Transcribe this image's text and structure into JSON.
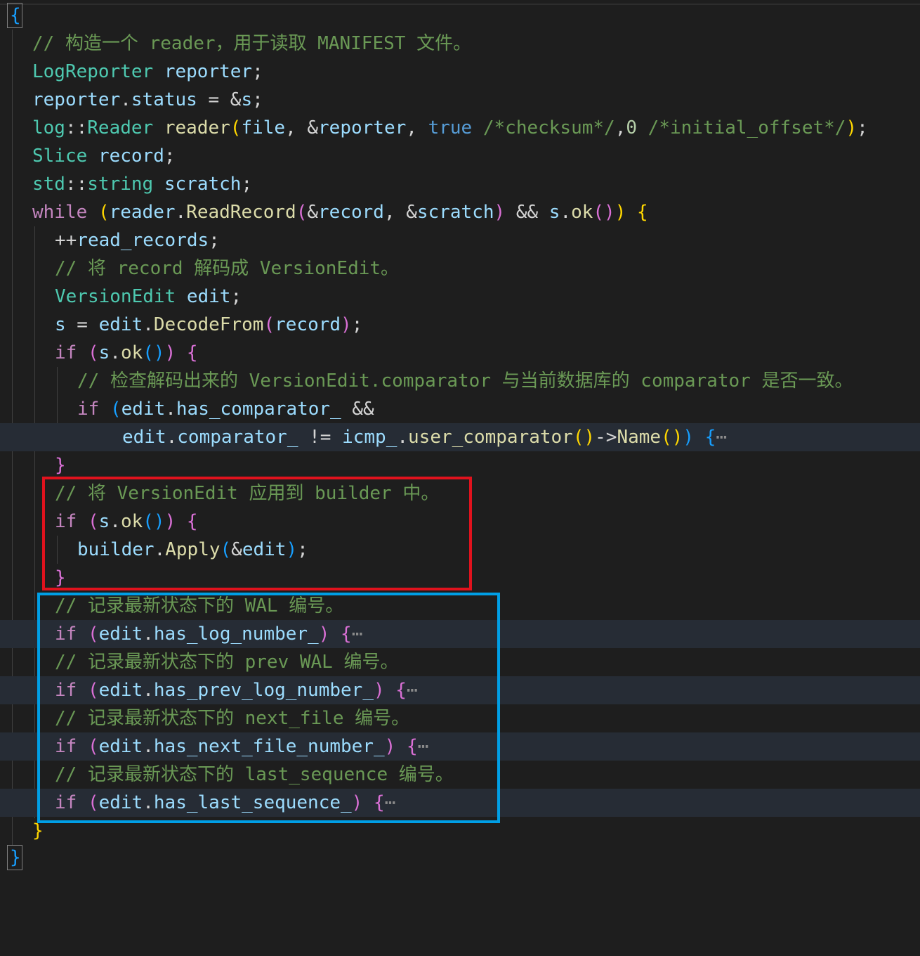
{
  "editor": {
    "lines": [
      {
        "id": "L0",
        "text": "{"
      },
      {
        "id": "L1",
        "comment": "// 构造一个 reader，用于读取 MANIFEST 文件。"
      },
      {
        "id": "L2",
        "type": "LogReporter",
        "var": "reporter",
        "end": ";"
      },
      {
        "id": "L3",
        "a": "reporter",
        "b": ".",
        "c": "status",
        "d": " = &",
        "e": "s",
        "f": ";"
      },
      {
        "id": "L4",
        "t1": "log",
        "t2": "::",
        "t3": "Reader",
        "v1": "reader",
        "v2": "file",
        "v3": "reporter",
        "kw": "true",
        "com1": "/*checksum*/",
        "num": "0",
        "com2": "/*initial_offset*/"
      },
      {
        "id": "L5",
        "type": "Slice",
        "var": "record",
        "end": ";"
      },
      {
        "id": "L6",
        "t1": "std",
        "t2": "::",
        "t3": "string",
        "var": "scratch",
        "end": ";"
      },
      {
        "id": "L7",
        "kw": "while",
        "v1": "reader",
        "fn1": "ReadRecord",
        "v2": "record",
        "v3": "scratch",
        "op": "&&",
        "v4": "s",
        "fn2": "ok"
      },
      {
        "id": "L8",
        "pre": "++",
        "var": "read_records",
        "end": ";"
      },
      {
        "id": "L9",
        "comment": "// 将 record 解码成 VersionEdit。"
      },
      {
        "id": "L10",
        "type": "VersionEdit",
        "var": "edit",
        "end": ";"
      },
      {
        "id": "L11",
        "v1": "s",
        "v2": "edit",
        "fn": "DecodeFrom",
        "v3": "record"
      },
      {
        "id": "L12",
        "kw": "if",
        "v1": "s",
        "fn": "ok"
      },
      {
        "id": "L13",
        "comment": "// 检查解码出来的 VersionEdit.comparator 与当前数据库的 comparator 是否一致。"
      },
      {
        "id": "L14",
        "kw": "if",
        "v1": "edit",
        "v2": "has_comparator_",
        "op": "&&"
      },
      {
        "id": "L15",
        "v1": "edit",
        "v2": "comparator_",
        "op": "!=",
        "v3": "icmp_",
        "fn1": "user_comparator",
        "arrow": "->",
        "fn2": "Name",
        "ellipsis": "⋯"
      },
      {
        "id": "L16",
        "text": "}"
      },
      {
        "id": "L17",
        "comment": "// 将 VersionEdit 应用到 builder 中。"
      },
      {
        "id": "L18",
        "kw": "if",
        "v1": "s",
        "fn": "ok"
      },
      {
        "id": "L19",
        "v1": "builder",
        "fn": "Apply",
        "v2": "edit"
      },
      {
        "id": "L20",
        "text": "}"
      },
      {
        "id": "L21",
        "comment": "// 记录最新状态下的 WAL 编号。"
      },
      {
        "id": "L22",
        "kw": "if",
        "v1": "edit",
        "v2": "has_log_number_",
        "ellipsis": "⋯"
      },
      {
        "id": "L23",
        "comment": "// 记录最新状态下的 prev WAL 编号。"
      },
      {
        "id": "L24",
        "kw": "if",
        "v1": "edit",
        "v2": "has_prev_log_number_",
        "ellipsis": "⋯"
      },
      {
        "id": "L25",
        "comment": "// 记录最新状态下的 next_file 编号。"
      },
      {
        "id": "L26",
        "kw": "if",
        "v1": "edit",
        "v2": "has_next_file_number_",
        "ellipsis": "⋯"
      },
      {
        "id": "L27",
        "comment": "// 记录最新状态下的 last_sequence 编号。"
      },
      {
        "id": "L28",
        "kw": "if",
        "v1": "edit",
        "v2": "has_last_sequence_",
        "ellipsis": "⋯"
      },
      {
        "id": "L29",
        "text": "}"
      },
      {
        "id": "L30",
        "text": "}"
      }
    ]
  },
  "colors": {
    "background": "#1e1e1e",
    "comment": "#6a9955",
    "type": "#4ec9b0",
    "variable": "#9cdcfe",
    "function": "#dcdcaa",
    "keyword": "#569cd6",
    "control": "#c586c0",
    "highlight_red": "#e0121d",
    "highlight_blue": "#009fe6"
  }
}
